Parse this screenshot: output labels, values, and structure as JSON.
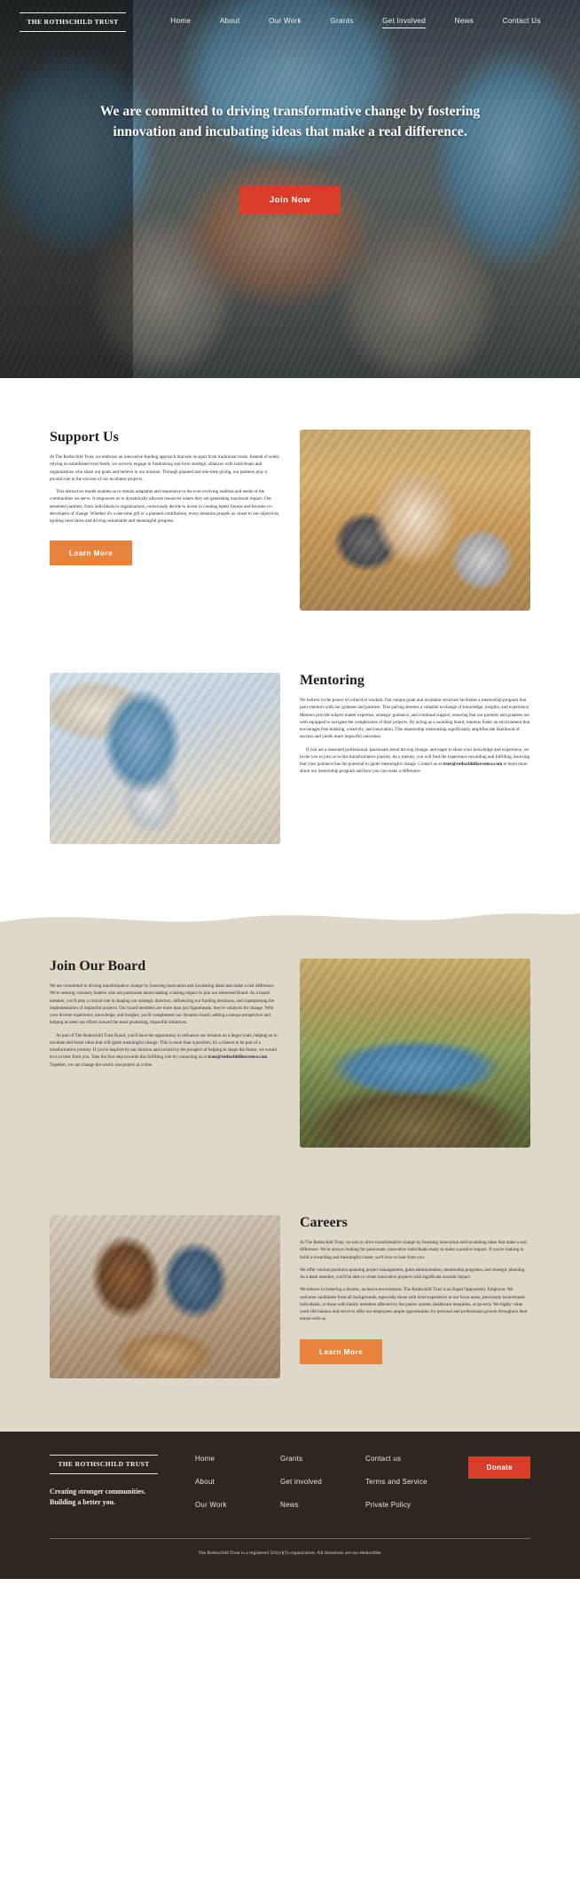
{
  "brand": {
    "name": "THE ROTHSCHILD TRUST"
  },
  "nav": {
    "items": [
      {
        "label": "Home",
        "active": false
      },
      {
        "label": "About",
        "active": false
      },
      {
        "label": "Our Work",
        "active": false
      },
      {
        "label": "Grants",
        "active": false
      },
      {
        "label": "Get Involved",
        "active": true
      },
      {
        "label": "News",
        "active": false
      },
      {
        "label": "Contact Us",
        "active": false
      }
    ]
  },
  "hero": {
    "headline": "We are committed to driving transformative change by fostering innovation and incubating ideas that make a real difference.",
    "cta_label": "Join Now",
    "cta_color": "#d93c28"
  },
  "support": {
    "title": "Support Us",
    "p1": "At The Rothschild Trust, we embrace an innovative funding approach that sets us apart from traditional trusts. Instead of solely relying on established trust funds, we actively engage in fundraising and form strategic alliances with individuals and organizations who share our goals and believe in our mission. Through planned and one-time giving, our partners play a pivotal role in the success of our incubator projects.",
    "p2": "This distinctive model enables us to remain adaptable and responsive to the ever-evolving realities and needs of the communities we serve. It empowers us to dynamically allocate resources where they are generating maximum impact. Our esteemed partners, from individuals to organizations, consciously decide to invest in creating better futures and become co-developers of change. Whether it's a one-time gift or a planned contribution, every donation propels us closer to our objectives, igniting innovation and driving sustainable and meaningful progress.",
    "cta_label": "Learn More",
    "cta_color": "#e8823c",
    "image_alt": "volunteer-serving-food-photo"
  },
  "mentoring": {
    "title": "Mentoring",
    "p1": "We believe in the power of collective wisdom. Our unique grant and incubator structure facilitates a mentorship program that pairs mentors with our grantees and partners. This pairing denotes a valuable exchange of knowledge, insights, and experience. Mentors provide subject matter expertise, strategic guidance, and continual support, ensuring that our partners and grantees are well-equipped to navigate the complexities of their projects. By acting as a sounding board, mentors foster an environment that encourages free thinking, creativity, and innovation. This mentorship relationship significantly amplifies the likelihood of success and yields more impactful outcomes.",
    "p2_pre": "If you are a seasoned professional, passionate about driving change, and eager to share your knowledge and experience, we invite you to join us in this transformative journey. As a mentor, you will find the experience rewarding and fulfilling, knowing that your guidance has the potential to ignite meaningful change. Contact us at ",
    "p2_email": "trust@rothschildlawrence.com",
    "p2_post": " to learn more about our mentorship program and how you can make a difference.",
    "image_alt": "mentor-and-student-photo"
  },
  "board": {
    "title": "Join Our Board",
    "p1": "We are committed to driving transformative change by fostering innovation and incubating ideas that make a real difference. We're seeking visionary leaders who are passionate about making a lasting impact to join our esteemed Board. As a board member, you'll play a crucial role in shaping our strategic direction, influencing our funding decisions, and championing the implementation of impactful projects. Our board members are more than just figureheads; they're catalysts for change. With your diverse experience, knowledge, and insights, you'll complement our dynamic board, adding a unique perspective and helping us steer our efforts toward the most promising, impactful initiatives.",
    "p2_pre": "As part of The Rothschild Trust Board, you'll have the opportunity to influence our mission on a larger scale, helping us to incubate and foster ideas that will ignite meaningful change. This is more than a position; it's a chance to be part of a transformative journey. If you're inspired by our mission and excited by the prospect of helping to shape the future, we would love to hear from you. Take the first step towards this fulfilling role by contacting us at ",
    "p2_email": "trust@rothschildlawrence.com",
    "p2_post": ". Together, we can change the world, one project at a time.",
    "image_alt": "team-walking-outdoors-photo"
  },
  "careers": {
    "title": "Careers",
    "p1": "At The Rothschild Trust, we aim to drive transformative change by fostering innovation and incubating ideas that make a real difference. We're always looking for passionate, innovative individuals ready to make a positive impact. If you're looking to build a rewarding and meaningful career, we'd love to hear from you.",
    "p2": "We offer various positions spanning project management, grant administration, mentorship programs, and strategic planning. As a team member, you'll be able to create innovative projects with significant societal impact.",
    "p3": "We believe in fostering a diverse, inclusive environment.  The Rothschild Trust is an Equal Opportunity Employer. We welcome candidates from all backgrounds, especially those with lived experience in our focus areas, previously incarcerated individuals, or those with family members affected by the justice system, healthcare inequities, or poverty. We highly value work-life balance and strive to offer our employees ample opportunities for personal and professional growth throughout their tenure with us.",
    "cta_label": "Learn More",
    "cta_color": "#e8823c",
    "image_alt": "volunteers-packing-boxes-photo"
  },
  "footer": {
    "brand_name": "THE ROTHSCHILD TRUST",
    "tagline_line1": "Creating stronger communities.",
    "tagline_line2": "Building a better you.",
    "columns": [
      {
        "links": [
          "Home",
          "About",
          "Our Work"
        ]
      },
      {
        "links": [
          "Grants",
          "Get involved",
          "News"
        ]
      },
      {
        "links": [
          "Contact us",
          "Terms and Service",
          "Private Policy"
        ]
      }
    ],
    "donate_label": "Donate",
    "donate_color": "#d93c28",
    "legal": "The Rothschild Trust is a registered 501(c)(3) organization. All donations are tax-deductible.",
    "background": "#2e2721"
  }
}
